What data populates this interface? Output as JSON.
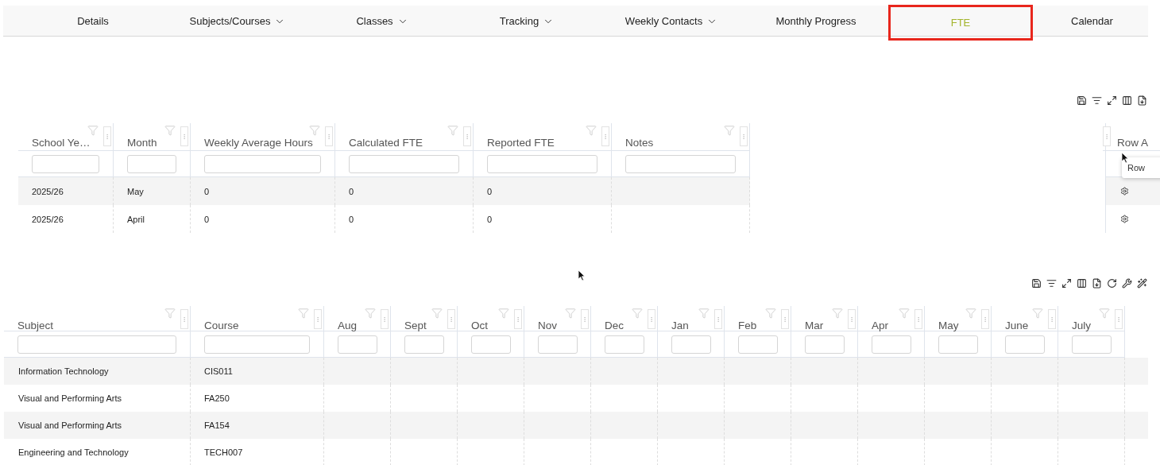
{
  "tabs": [
    {
      "label": "Details",
      "has_menu": false,
      "selected": false
    },
    {
      "label": "Subjects/Courses",
      "has_menu": true,
      "selected": false
    },
    {
      "label": "Classes",
      "has_menu": true,
      "selected": false
    },
    {
      "label": "Tracking",
      "has_menu": true,
      "selected": false
    },
    {
      "label": "Weekly Contacts",
      "has_menu": true,
      "selected": false
    },
    {
      "label": "Monthly Progress",
      "has_menu": false,
      "selected": false
    },
    {
      "label": "FTE",
      "has_menu": false,
      "selected": true
    },
    {
      "label": "Calendar",
      "has_menu": false,
      "selected": false
    }
  ],
  "fte_table": {
    "columns": [
      "School Ye…",
      "Month",
      "Weekly Average Hours",
      "Calculated FTE",
      "Reported FTE",
      "Notes"
    ],
    "action_column": "Row A",
    "tooltip": "Row",
    "rows": [
      {
        "cells": [
          "2025/26",
          "May",
          "0",
          "0",
          "0"
        ]
      },
      {
        "cells": [
          "2025/26",
          "April",
          "0",
          "0",
          "0"
        ]
      }
    ]
  },
  "courses_table": {
    "columns": [
      "Subject",
      "Course",
      "Aug",
      "Sept",
      "Oct",
      "Nov",
      "Dec",
      "Jan",
      "Feb",
      "Mar",
      "Apr",
      "May",
      "June",
      "July"
    ],
    "rows": [
      {
        "cells": [
          "Information Technology",
          "CIS011"
        ]
      },
      {
        "cells": [
          "Visual and Performing Arts",
          "FA250"
        ]
      },
      {
        "cells": [
          "Visual and Performing Arts",
          "FA154"
        ]
      },
      {
        "cells": [
          "Engineering and Technology",
          "TECH007"
        ]
      }
    ]
  }
}
